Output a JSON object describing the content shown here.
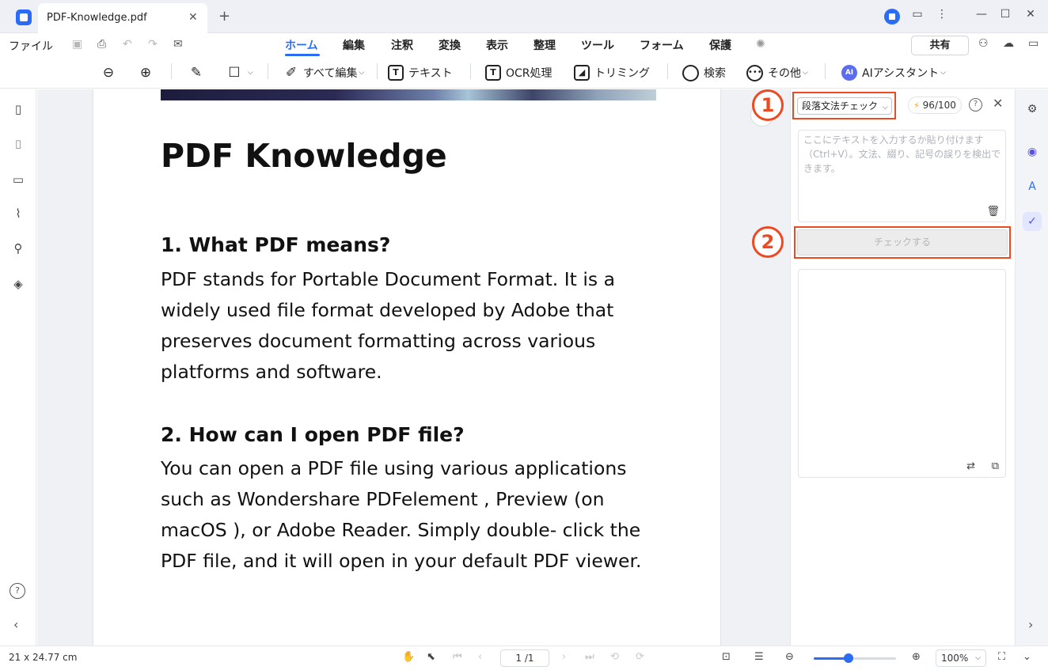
{
  "titlebar": {
    "tab_title": "PDF-Knowledge.pdf",
    "close_glyph": "✕",
    "new_tab_glyph": "+",
    "icons": [
      "brand-icon",
      "feedback-icon",
      "more-icon",
      "minimize-icon",
      "maximize-icon",
      "close-window-icon"
    ]
  },
  "menubar": {
    "file": "ファイル",
    "items": [
      "ホーム",
      "編集",
      "注釈",
      "変換",
      "表示",
      "整理",
      "ツール",
      "フォーム",
      "保護"
    ],
    "active_item": "ホーム",
    "share": "共有"
  },
  "toolbar": {
    "edit_all": "すべて編集",
    "text": "テキスト",
    "ocr": "OCR処理",
    "crop": "トリミング",
    "search": "検索",
    "more": "その他",
    "ai_assistant": "AIアシスタント",
    "ai_badge": "AI"
  },
  "document": {
    "title": "PDF Knowledge",
    "h1": "1. What PDF means?",
    "p1": "PDF stands for Portable Document Format. It is a widely used file format developed by Adobe that preserves document formatting across various platforms and software.",
    "h2": "2. How can I open PDF file?",
    "p2": "You can open a PDF file using various applications such as Wondershare PDFelement , Preview (on macOS ), or Adobe Reader. Simply double- click the PDF file, and it will open in your default PDF viewer."
  },
  "panel": {
    "mode": "段落文法チェック",
    "credits": "96/100",
    "input_placeholder": "ここにテキストを入力するか貼り付けます（Ctrl+V）。文法、綴り、記号の誤りを検出できます。",
    "check_button": "チェックする",
    "markers": [
      "1",
      "2"
    ]
  },
  "statusbar": {
    "dimensions": "21 x 24.77 cm",
    "page": "1 /1",
    "zoom": "100%",
    "zoom_level": 0.42
  },
  "colors": {
    "accent": "#2a6df4",
    "highlight": "#ec4a23"
  }
}
